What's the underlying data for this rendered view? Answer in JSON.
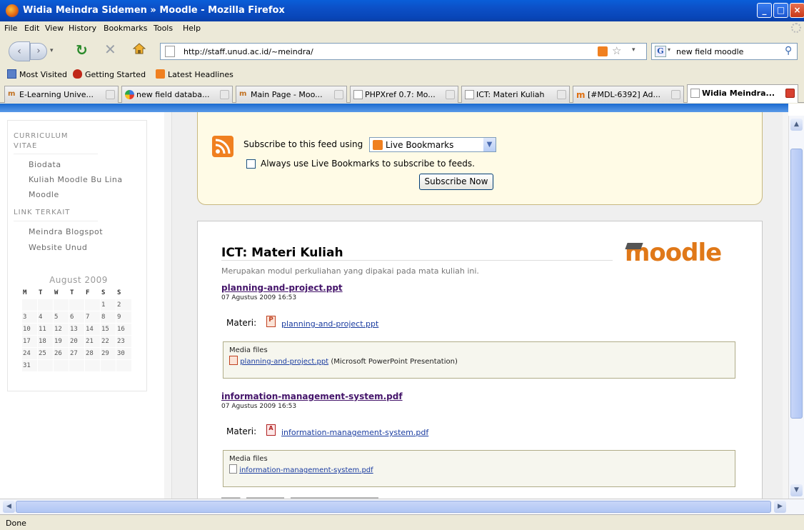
{
  "window": {
    "title": "Widia Meindra Sidemen » Moodle - Mozilla Firefox"
  },
  "menu": [
    "File",
    "Edit",
    "View",
    "History",
    "Bookmarks",
    "Tools",
    "Help"
  ],
  "url": "http://staff.unud.ac.id/~meindra/",
  "search": {
    "value": "new field moodle"
  },
  "bookmarks": [
    "Most Visited",
    "Getting Started",
    "Latest Headlines"
  ],
  "tabs": [
    {
      "label": "E-Learning Unive...",
      "icon": "moodle-icon"
    },
    {
      "label": "new field databa...",
      "icon": "google-icon"
    },
    {
      "label": "Main Page - Moo...",
      "icon": "moodle-icon"
    },
    {
      "label": "PHPXref 0.7: Mo...",
      "icon": "page-icon"
    },
    {
      "label": "ICT: Materi Kuliah",
      "icon": "page-icon"
    },
    {
      "label": "[#MDL-6392] Ad...",
      "icon": "moodle-tracker-icon"
    },
    {
      "label": "Widia Meindra...",
      "icon": "page-icon"
    }
  ],
  "sidebar": {
    "curriculum_line1": "CURRICULUM",
    "curriculum_line2": "VITAE",
    "items": [
      "Biodata",
      "Kuliah Moodle Bu Lina",
      "Moodle"
    ],
    "link_heading": "LINK TERKAIT",
    "links": [
      "Meindra Blogspot",
      "Website Unud"
    ]
  },
  "calendar": {
    "title": "August 2009",
    "days": [
      "M",
      "T",
      "W",
      "T",
      "F",
      "S",
      "S"
    ],
    "weeks": [
      [
        "",
        "",
        "",
        "",
        "",
        "1",
        "2"
      ],
      [
        "3",
        "4",
        "5",
        "6",
        "7",
        "8",
        "9"
      ],
      [
        "10",
        "11",
        "12",
        "13",
        "14",
        "15",
        "16"
      ],
      [
        "17",
        "18",
        "19",
        "20",
        "21",
        "22",
        "23"
      ],
      [
        "24",
        "25",
        "26",
        "27",
        "28",
        "29",
        "30"
      ],
      [
        "31",
        "",
        "",
        "",
        "",
        "",
        ""
      ]
    ]
  },
  "subscribe": {
    "label": "Subscribe to this feed using",
    "select_value": "Live Bookmarks",
    "checkbox_label": "Always use Live Bookmarks to subscribe to feeds.",
    "button": "Subscribe Now"
  },
  "feed": {
    "title": "ICT: Materi Kuliah",
    "subtitle": "Merupakan modul perkuliahan yang dipakai pada mata kuliah ini.",
    "logo": "moodle",
    "entries": [
      {
        "title": "planning-and-project.ppt",
        "date": "07 Agustus 2009 16:53",
        "materi_label": "Materi:",
        "file": "planning-and-project.ppt",
        "media_label": "Media files",
        "media_file": "planning-and-project.ppt",
        "media_type": "(Microsoft PowerPoint Presentation)"
      },
      {
        "title": "information-management-system.pdf",
        "date": "07 Agustus 2009 16:53",
        "materi_label": "Materi:",
        "file": "information-management-system.pdf",
        "media_label": "Media files",
        "media_file": "information-management-system.pdf",
        "media_type": ""
      }
    ]
  },
  "status": "Done",
  "colors": {
    "title_bar": "#0a5ed8",
    "link": "#1a3ca0",
    "visited": "#44146a",
    "rss": "#f08020",
    "subscribe_bg": "#fffbe6"
  }
}
